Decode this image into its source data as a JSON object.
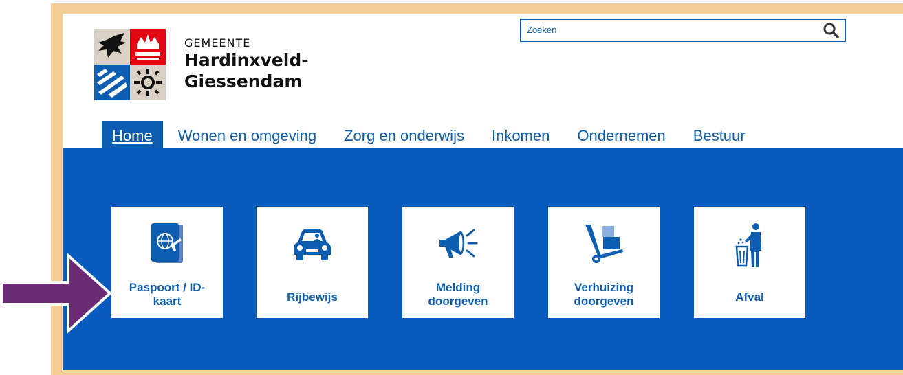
{
  "header": {
    "org_prefix": "GEMEENTE",
    "org_name_line1": "Hardinxveld-",
    "org_name_line2": "Giessendam"
  },
  "search": {
    "placeholder": "Zoeken"
  },
  "nav": {
    "items": [
      {
        "label": "Home",
        "active": true
      },
      {
        "label": "Wonen en omgeving"
      },
      {
        "label": "Zorg en onderwijs"
      },
      {
        "label": "Inkomen"
      },
      {
        "label": "Ondernemen"
      },
      {
        "label": "Bestuur"
      }
    ]
  },
  "tiles": [
    {
      "label": "Paspoort / ID-kaart",
      "icon": "passport-icon"
    },
    {
      "label": "Rijbewijs",
      "icon": "car-icon"
    },
    {
      "label": "Melding doorgeven",
      "icon": "megaphone-icon"
    },
    {
      "label": "Verhuizing doorgeven",
      "icon": "hand-truck-icon"
    },
    {
      "label": "Afval",
      "icon": "trash-bin-icon"
    }
  ],
  "colors": {
    "accent": "#0a5bbe",
    "frame": "#f5cd96",
    "pointer_arrow": "#6b2a74"
  }
}
